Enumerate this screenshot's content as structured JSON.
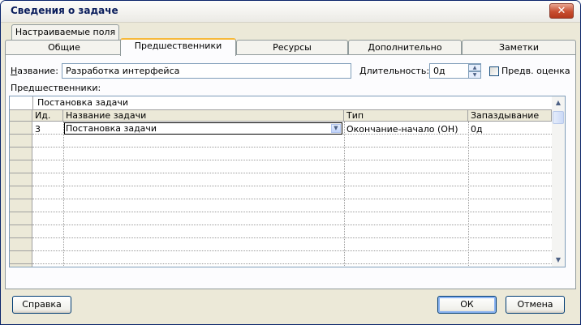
{
  "window": {
    "title": "Сведения о задаче",
    "close_glyph": "✕"
  },
  "tabs": {
    "row1": [
      {
        "label": "Настраиваемые поля"
      }
    ],
    "row2": [
      {
        "label": "Общие"
      },
      {
        "label": "Предшественники",
        "active": true
      },
      {
        "label": "Ресурсы"
      },
      {
        "label": "Дополнительно"
      },
      {
        "label": "Заметки"
      }
    ]
  },
  "form": {
    "name_label": "Название:",
    "name_value": "Разработка интерфейса",
    "duration_label": "Длительность:",
    "duration_value": "0д",
    "estimated_label": "Предв. оценка",
    "estimated_checked": false,
    "predecessors_label": "Предшественники:"
  },
  "grid": {
    "edit_value": "Постановка задачи",
    "columns": [
      "Ид.",
      "Название задачи",
      "Тип",
      "Запаздывание"
    ],
    "rows": [
      {
        "id": "3",
        "name": "Постановка задачи",
        "type": "Окончание-начало (ОН)",
        "lag": "0д"
      }
    ],
    "empty_row_count": 11
  },
  "buttons": {
    "help": "Справка",
    "ok": "ОК",
    "cancel": "Отмена"
  },
  "colors": {
    "title_text": "#0a1d5c",
    "window_bg": "#ece9d8",
    "active_tab_accent": "#f7b93a",
    "close_button": "#c84e30"
  }
}
